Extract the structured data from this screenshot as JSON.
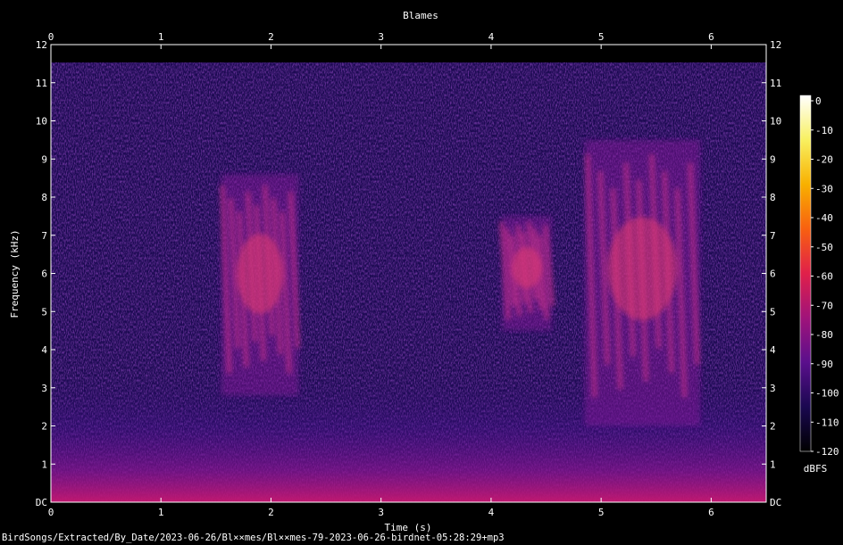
{
  "chart_data": {
    "type": "heatmap",
    "title": "Blames",
    "xlabel": "Time (s)",
    "ylabel": "Frequency (kHz)",
    "xlim": [
      0,
      6.5
    ],
    "ylim": [
      0,
      12
    ],
    "x_ticks": [
      "0",
      "1",
      "2",
      "3",
      "4",
      "5",
      "6"
    ],
    "y_ticks": [
      "DC",
      "1",
      "2",
      "3",
      "4",
      "5",
      "6",
      "7",
      "8",
      "9",
      "10",
      "11",
      "12"
    ],
    "colorbar": {
      "label": "dBFS",
      "ticks": [
        "0",
        "-10",
        "-20",
        "-30",
        "-40",
        "-50",
        "-60",
        "-70",
        "-80",
        "-90",
        "-100",
        "-110",
        "-120"
      ],
      "range": [
        -120,
        0
      ],
      "colors": [
        "#000000",
        "#1a0850",
        "#5a0f8c",
        "#a0137a",
        "#e0204a",
        "#f86010",
        "#f8b000",
        "#f8f060",
        "#ffffff"
      ]
    },
    "calls": [
      {
        "t_start": 1.55,
        "t_end": 2.25,
        "f_low": 2.8,
        "f_high": 8.6
      },
      {
        "t_start": 4.1,
        "t_end": 4.55,
        "f_low": 4.5,
        "f_high": 7.5
      },
      {
        "t_start": 4.85,
        "t_end": 5.9,
        "f_low": 2.0,
        "f_high": 9.5
      }
    ]
  },
  "footer": {
    "path": "BirdSongs/Extracted/By_Date/2023-06-26/Bl××mes/Bl××mes-79-2023-06-26-birdnet-05:28:29+mp3"
  }
}
